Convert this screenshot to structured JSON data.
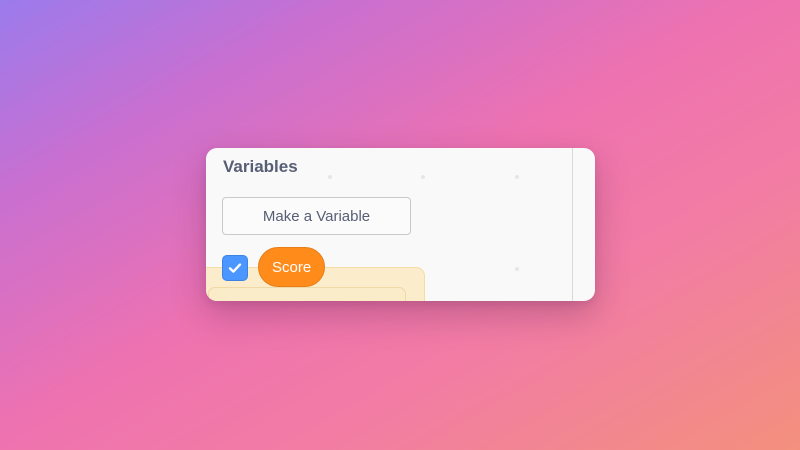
{
  "palette": {
    "panel_background": "#f9f9f9",
    "variable_color": "#ff8c1a",
    "checkbox_color": "#4c97ff",
    "title_color": "#575e75"
  },
  "category": {
    "title": "Variables"
  },
  "make_variable_button": {
    "label": "Make a Variable"
  },
  "variables": [
    {
      "name": "Score",
      "checked": true,
      "checkbox_icon": "checkmark-icon"
    }
  ]
}
